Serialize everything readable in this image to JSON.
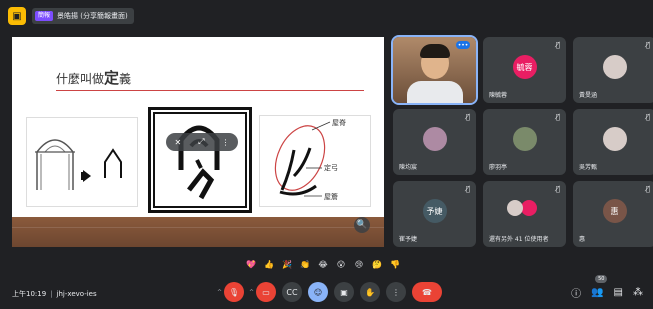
{
  "topbar": {
    "present_tag": "簡報",
    "present_text": "景皓揚 (分享簡報畫面)"
  },
  "slide": {
    "title_prefix": "什麼叫做",
    "title_emphasis": "定",
    "title_suffix": "義",
    "annotations": [
      "屋脊",
      "定弓",
      "屋簷"
    ]
  },
  "presentation_overlay": {
    "pin_icon": "pin-off-icon",
    "more_icon": "more-vert-icon"
  },
  "participants": [
    {
      "name": "",
      "avatar_text": "",
      "color": "#5f6368",
      "type": "photo"
    },
    {
      "name": "陳毓蓉",
      "avatar_text": "毓蓉",
      "color": "#e91e63",
      "type": "initials"
    },
    {
      "name": "黃旻涵",
      "avatar_text": "",
      "color": "#d7ccc8",
      "type": "image"
    },
    {
      "name": "陳均宸",
      "avatar_text": "",
      "color": "#ad8aa3",
      "type": "image"
    },
    {
      "name": "廖羽亭",
      "avatar_text": "",
      "color": "#7a8a6a",
      "type": "image"
    },
    {
      "name": "吳芳甄",
      "avatar_text": "",
      "color": "#d7ccc8",
      "type": "image"
    },
    {
      "name": "崔予婕",
      "avatar_text": "予婕",
      "color": "#455a64",
      "type": "initials"
    },
    {
      "name": "還有另外 41 位使用者",
      "avatar_text": "",
      "color": "#3c4043",
      "type": "group"
    },
    {
      "name": "惠",
      "avatar_text": "惠",
      "color": "#795548",
      "type": "initials"
    }
  ],
  "reactions": [
    "💖",
    "👍",
    "🎉",
    "👏",
    "😂",
    "😮",
    "😢",
    "🤔",
    "👎"
  ],
  "bottom": {
    "time": "上午10:19",
    "separator": "|",
    "meeting_code": "jhj-xevo-ies",
    "participant_count": "50"
  },
  "colors": {
    "background": "#202124",
    "tile": "#3c4043",
    "accent": "#8ab4f8",
    "danger": "#ea4335"
  }
}
